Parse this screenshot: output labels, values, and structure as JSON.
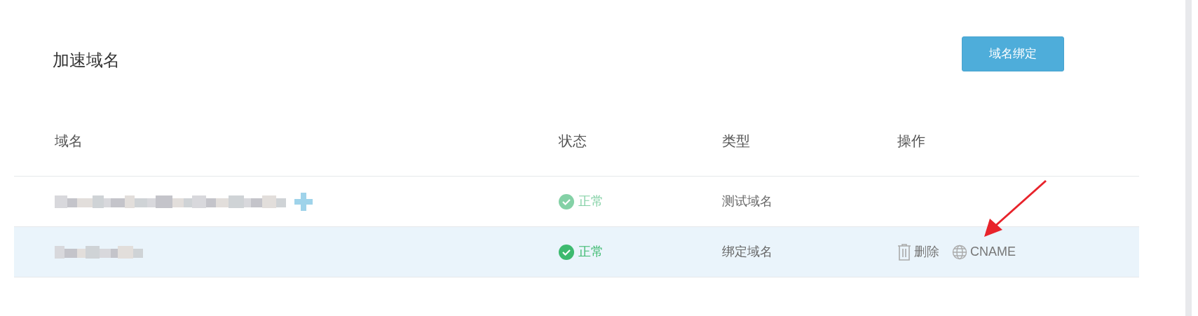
{
  "title": "加速域名",
  "bind_button": "域名绑定",
  "columns": [
    "域名",
    "状态",
    "类型",
    "操作"
  ],
  "rows": [
    {
      "tagged": true,
      "status": {
        "text": "正常",
        "color": "#84d1a6"
      },
      "type": "测试域名",
      "highlighted": false
    },
    {
      "tagged": false,
      "status": {
        "text": "正常",
        "color": "#3dba6f"
      },
      "type": "绑定域名",
      "highlighted": true,
      "actions": [
        {
          "kind": "delete",
          "label": "删除"
        },
        {
          "kind": "cname",
          "label": "CNAME"
        }
      ]
    }
  ]
}
